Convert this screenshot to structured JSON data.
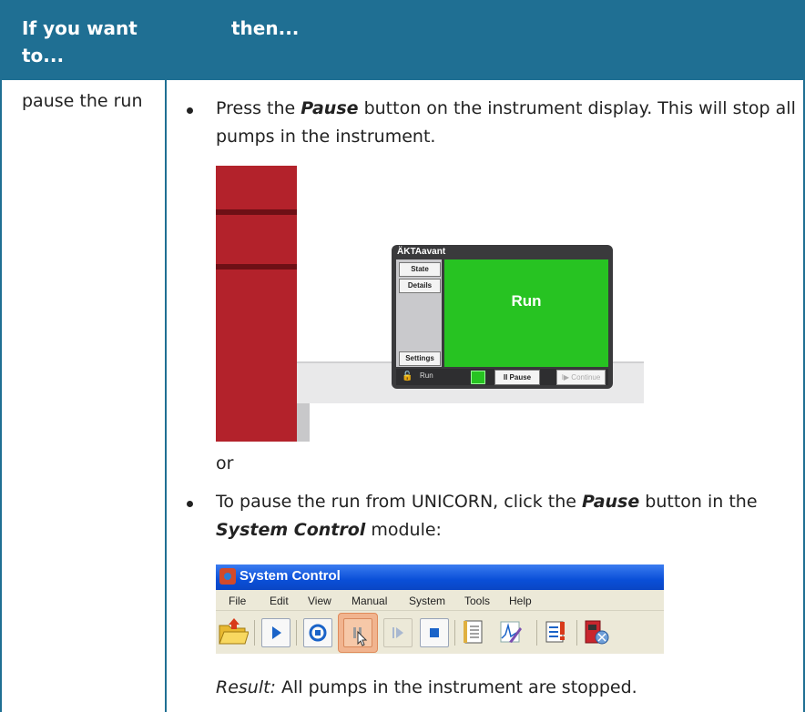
{
  "table": {
    "header_col1": "If you want to...",
    "header_col2": "then...",
    "row_label": "pause the run"
  },
  "bullet1": {
    "prefix": "Press the ",
    "em": "Pause",
    "suffix": " button on the instrument display. This will stop all pumps in the instrument."
  },
  "or_text": "or",
  "bullet2": {
    "prefix": "To pause the run from UNICORN, click the ",
    "em1": "Pause",
    "middle": " button in the ",
    "em2": "System Control",
    "suffix": " module:"
  },
  "result": {
    "label": "Result:",
    "text": " All pumps in the instrument are stopped."
  },
  "instrument_screen": {
    "title": "ÄKTAavant",
    "state_btn": "State",
    "details_btn": "Details",
    "settings_btn": "Settings",
    "status_big": "Run",
    "status_small": "Run",
    "pause_btn": "II Pause",
    "continue_btn": "I▶ Continue"
  },
  "system_control": {
    "title": "System Control",
    "menu": [
      "File",
      "Edit",
      "View",
      "Manual",
      "System",
      "Tools",
      "Help"
    ],
    "toolbar_icons": [
      "folder-icon",
      "play-icon",
      "hold-icon",
      "pause-icon",
      "step-icon",
      "stop-icon",
      "logbook-icon",
      "curve-icon",
      "checklist-icon",
      "instrument-icon"
    ]
  },
  "colors": {
    "header": "#1f6f93",
    "screen_green": "#27c322",
    "instrument_red": "#b3222b"
  }
}
